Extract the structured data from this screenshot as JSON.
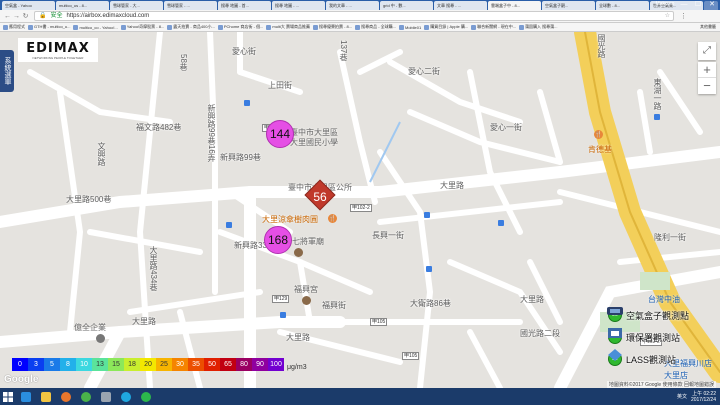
{
  "browser": {
    "tabs": [
      {
        "label": "空氣盒 - Yahoo"
      },
      {
        "label": "multico_us - 8..."
      },
      {
        "label": "雪球管家 - 大..."
      },
      {
        "label": "雪球管家 - ..."
      },
      {
        "label": "搜尋 地圖 - 首..."
      },
      {
        "label": "搜尋 地圖 - ..."
      },
      {
        "label": "我的文章 - ..."
      },
      {
        "label": "grid 中 - 數..."
      },
      {
        "label": "文章 搜尋 - ..."
      },
      {
        "label": "雲端盒子中 - 8..."
      },
      {
        "label": "空氣盒子觀..."
      },
      {
        "label": "全球數 - 8..."
      },
      {
        "label": "世界空氣質..."
      }
    ],
    "window_controls": {
      "minimize": "—",
      "maximize": "☐",
      "close": "✕"
    },
    "user": "Mako.co",
    "address": {
      "security": "安全",
      "url": "https://airbox.edimaxcloud.com"
    },
    "bookmarks": [
      "應用程式",
      "GTH書 - multico_u...",
      "multico_co - Yahoo!...",
      "Yahoo!奇摩股票 - 8...",
      "露天拍賣 - 商品400小...",
      "PChome 商店街 - 個...",
      "multi大 賣場商品推薦",
      "搜尋優賽拍賣 - 8...",
      "搜尋商品 - 全球購...",
      "Mobile01",
      "購買目錄 | Apple 購...",
      "聯合新聞網 - 現在中...",
      "蒲園購入 搜尋蒲..."
    ],
    "bookmark_other": "其他書籤"
  },
  "map": {
    "brand": {
      "name": "EDIMAX",
      "tagline": "NETWORKING PEOPLE TOGETHER"
    },
    "side_tab": "系統選單",
    "fullscreen_icon": "⤢",
    "zoom": {
      "in": "+",
      "out": "−"
    },
    "streets": {
      "shangtian": "上田街",
      "fuwen482": "福文路482巷",
      "wenxing": "文興路",
      "xinfu99_16": "新興路99巷16弄",
      "xinxing99": "新興路99巷",
      "dali500": "大里路500巷",
      "dali_a": "大里路",
      "dali_b": "大里路",
      "dali_c": "大里路",
      "dali_d": "大里路",
      "changxing1": "長興一街",
      "xinxing33": "新興路33巷",
      "fuxing": "福興街",
      "dahai86": "大衛路86巷",
      "aixin": "愛心街",
      "aixin2": "愛心二街",
      "aixin1": "愛心一街",
      "guoguang": "國光路",
      "donghu1": "東湖一路",
      "longli1": "隆利一街",
      "hongdao": "鴻道路",
      "street137": "137巷",
      "dali434": "大里路434巷",
      "street58": "58巷",
      "guoguang2": "國光路二段"
    },
    "pois": {
      "school": "臺中市大里區大里國民小學",
      "school_line1": "臺中市大里區",
      "school_line2": "大里國民小學",
      "district_office": "臺中市大里區公所",
      "restaurant": "大里涼傘樹肉圓",
      "temple": "七將軍廟",
      "fuxing_temple": "福興宮",
      "kfc": "肯德基",
      "kfc_icon": "🍴",
      "enterprise": "億全企業",
      "cpc": "台灣中油",
      "store1": "大里福興川店",
      "store2": "大里店"
    },
    "route_shields": [
      "甲102-2",
      "甲102-2",
      "甲129",
      "甲105",
      "甲105",
      "甲102-2"
    ],
    "sensors": [
      {
        "value": "144",
        "color": "#e54fe5"
      },
      {
        "value": "168",
        "color": "#e54fe5"
      }
    ],
    "epa_station": {
      "value": "56",
      "color": "#c0392b"
    },
    "legend": [
      {
        "label": "空氣盒子觀測點",
        "badge": "20",
        "icon": "airbox-icon"
      },
      {
        "label": "環保署觀測站",
        "badge": "20",
        "icon": "epa-icon"
      },
      {
        "label": "LASS觀測站",
        "badge": "20",
        "icon": "lass-icon"
      }
    ],
    "pm_scale": {
      "unit": "μg/m3",
      "levels": [
        {
          "value": "0",
          "color": "#0000ff"
        },
        {
          "value": "3",
          "color": "#0a3ff0"
        },
        {
          "value": "5",
          "color": "#1a7ae8"
        },
        {
          "value": "8",
          "color": "#22b0ea"
        },
        {
          "value": "10",
          "color": "#3cd8e0"
        },
        {
          "value": "13",
          "color": "#5be39b"
        },
        {
          "value": "15",
          "color": "#8ce85a"
        },
        {
          "value": "18",
          "color": "#c9ee2e"
        },
        {
          "value": "20",
          "color": "#f3e800"
        },
        {
          "value": "25",
          "color": "#f7b400"
        },
        {
          "value": "30",
          "color": "#f58400"
        },
        {
          "value": "35",
          "color": "#ec4f00"
        },
        {
          "value": "50",
          "color": "#e01f00"
        },
        {
          "value": "65",
          "color": "#c10012"
        },
        {
          "value": "80",
          "color": "#9a0062"
        },
        {
          "value": "90",
          "color": "#8f009f"
        },
        {
          "value": "100",
          "color": "#7200d0"
        }
      ]
    },
    "google_logo": "Google",
    "attribution": "地圖資料©2017 Google  使用條款  回報地圖錯誤"
  },
  "taskbar": {
    "lang": "英文",
    "clock_time": "上午 02:22",
    "clock_date": "2017/12/24",
    "apps": [
      {
        "name": "ie",
        "color": "#2a8ee0"
      },
      {
        "name": "explorer",
        "color": "#f2c542"
      },
      {
        "name": "firefox",
        "color": "#e8762c"
      },
      {
        "name": "chrome",
        "color": "#4ab34a"
      },
      {
        "name": "settings",
        "color": "#9aa4b0"
      },
      {
        "name": "skype",
        "color": "#1fa8e0"
      },
      {
        "name": "line",
        "color": "#2cb84c"
      }
    ]
  }
}
